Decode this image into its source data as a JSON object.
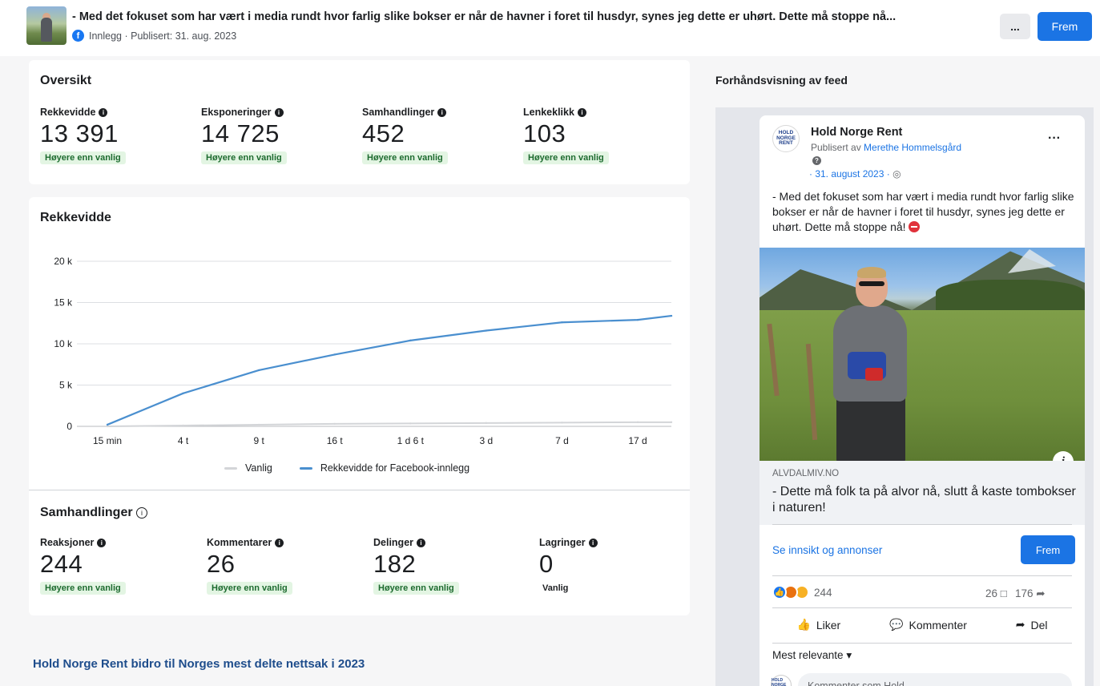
{
  "header": {
    "post_title": "- Med det fokuset som har vært i media rundt hvor farlig slike bokser er når de havner i foret til husdyr, synes jeg dette er uhørt. Dette må stoppe nå...",
    "meta": "Innlegg · Publisert: 31. aug. 2023",
    "more_label": "...",
    "boost_label": "Frem"
  },
  "overview": {
    "title": "Oversikt",
    "metrics": [
      {
        "label": "Rekkevidde",
        "value": "13 391",
        "badge": "Høyere enn vanlig"
      },
      {
        "label": "Eksponeringer",
        "value": "14 725",
        "badge": "Høyere enn vanlig"
      },
      {
        "label": "Samhandlinger",
        "value": "452",
        "badge": "Høyere enn vanlig"
      },
      {
        "label": "Lenkeklikk",
        "value": "103",
        "badge": "Høyere enn vanlig"
      }
    ]
  },
  "reach_chart": {
    "title": "Rekkevidde"
  },
  "chart_data": {
    "type": "line",
    "x": [
      "15 min",
      "4 t",
      "9 t",
      "16 t",
      "1 d 6 t",
      "3 d",
      "7 d",
      "17 d"
    ],
    "y_ticks": [
      "0",
      "5 k",
      "10 k",
      "15 k",
      "20 k"
    ],
    "ylim": [
      0,
      20000
    ],
    "grid": true,
    "legend": "bottom",
    "series": [
      {
        "name": "Vanlig",
        "color": "#d3d5d8",
        "values": [
          0,
          100,
          200,
          300,
          350,
          400,
          450,
          500
        ]
      },
      {
        "name": "Rekkevidde for Facebook-innlegg",
        "color": "#4a8fcf",
        "values": [
          200,
          4000,
          6800,
          8700,
          10400,
          11600,
          12600,
          12900
        ]
      }
    ],
    "final_value": 13391
  },
  "interactions": {
    "title": "Samhandlinger",
    "metrics": [
      {
        "label": "Reaksjoner",
        "value": "244",
        "badge": "Høyere enn vanlig"
      },
      {
        "label": "Kommentarer",
        "value": "26",
        "badge": "Høyere enn vanlig"
      },
      {
        "label": "Delinger",
        "value": "182",
        "badge": "Høyere enn vanlig"
      },
      {
        "label": "Lagringer",
        "value": "0",
        "badge": "Vanlig"
      }
    ]
  },
  "caption": "Hold Norge Rent bidro til Norges mest delte nettsak i 2023",
  "preview": {
    "title": "Forhåndsvisning av feed",
    "page_name": "Hold Norge Rent",
    "logo_text": "HOLD NORGE RENT",
    "published_by_prefix": "Publisert av ",
    "published_by": "Merethe Hommelsgård",
    "date": "· 31. august 2023 ·",
    "text": "- Med det fokuset som har vært i media rundt hvor farlig slike bokser er når de havner i foret til husdyr, synes jeg dette er uhørt. Dette må stoppe nå!",
    "link_domain": "ALVDALMIV.NO",
    "link_title": "- Dette må folk ta på alvor nå, slutt å kaste tombokser i naturen!",
    "insight_link": "Se innsikt og annonser",
    "boost_label": "Frem",
    "reaction_count": "244",
    "comment_count": "26",
    "share_count": "176",
    "actions": {
      "like": "Liker",
      "comment": "Kommenter",
      "share": "Del"
    },
    "sort_label": "Mest relevante",
    "comment_placeholder": "Kommenter som Hold..."
  }
}
